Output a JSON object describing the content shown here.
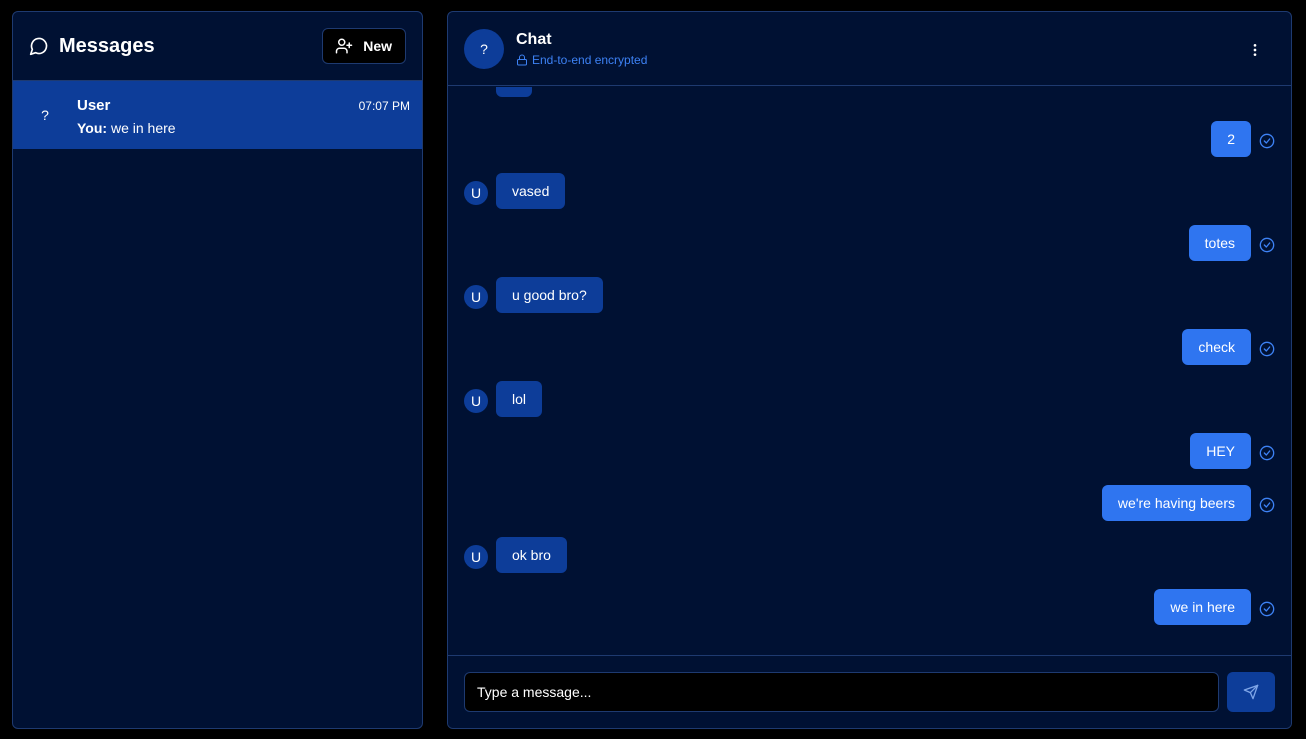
{
  "colors": {
    "background": "#000000",
    "panel": "#001133",
    "border": "#1e3a70",
    "selected": "#0d3d99",
    "incoming_bubble": "#0d3d99",
    "outgoing_bubble": "#2f75f0",
    "accent": "#3d82f5"
  },
  "sidebar": {
    "title": "Messages",
    "title_icon": "message-circle-icon",
    "new_button_label": "New",
    "new_button_icon": "user-plus-icon",
    "conversations": [
      {
        "avatar": "?",
        "name": "User",
        "time": "07:07 PM",
        "preview_prefix": "You:",
        "preview_text": "we in here",
        "selected": true
      }
    ]
  },
  "chat": {
    "avatar": "?",
    "title": "Chat",
    "encryption_label": "End-to-end encrypted",
    "encryption_icon": "lock-icon",
    "menu_icon": "more-vertical-icon",
    "messages": [
      {
        "direction": "out",
        "text": "2"
      },
      {
        "direction": "in",
        "avatar": "U",
        "text": "vased"
      },
      {
        "direction": "out",
        "text": "totes"
      },
      {
        "direction": "in",
        "avatar": "U",
        "text": "u good bro?"
      },
      {
        "direction": "out",
        "text": "check"
      },
      {
        "direction": "in",
        "avatar": "U",
        "text": "lol"
      },
      {
        "direction": "out",
        "text": "HEY"
      },
      {
        "direction": "out",
        "text": "we're having beers"
      },
      {
        "direction": "in",
        "avatar": "U",
        "text": "ok bro"
      },
      {
        "direction": "out",
        "text": "we in here"
      }
    ],
    "composer": {
      "placeholder": "Type a message...",
      "value": "",
      "send_icon": "send-icon"
    }
  }
}
